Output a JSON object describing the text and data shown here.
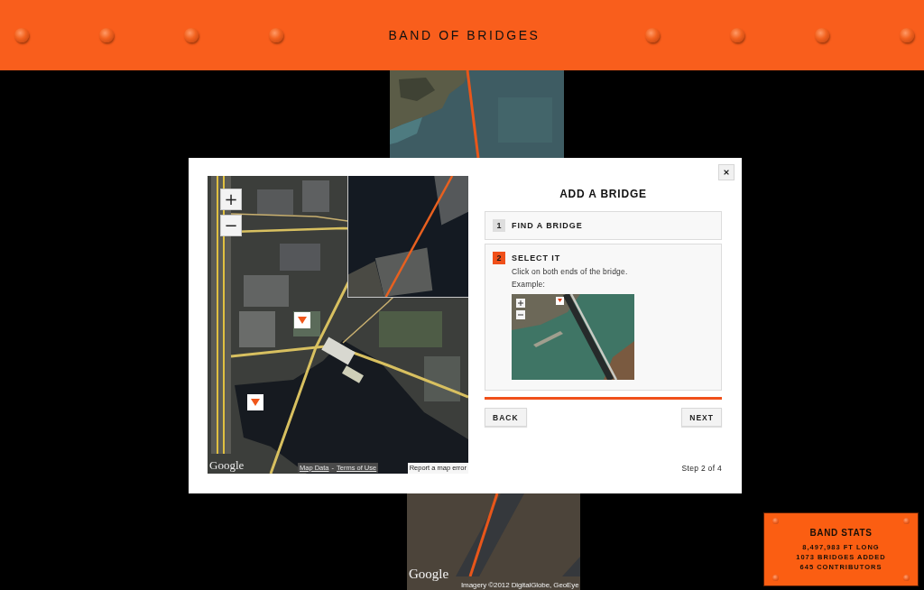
{
  "header": {
    "title": "BAND OF BRIDGES"
  },
  "background_map": {
    "logo": "Google",
    "attribution": "Imagery ©2012 DigitalGlobe, GeoEye"
  },
  "dialog": {
    "title": "ADD A BRIDGE",
    "map": {
      "zoom_in": "+",
      "zoom_out": "−",
      "logo": "Google",
      "links": [
        "Map Data",
        "Terms of Use"
      ],
      "link_separator": "-",
      "report": "Report a map error"
    },
    "steps": [
      {
        "number": "1",
        "title": "FIND A BRIDGE",
        "selected": false
      },
      {
        "number": "2",
        "title": "SELECT IT",
        "selected": true,
        "description": "Click on both ends of the bridge.",
        "example_label": "Example:"
      }
    ],
    "buttons": [
      {
        "kind": "back",
        "label": "BACK"
      },
      {
        "kind": "next",
        "label": "NEXT"
      }
    ],
    "step_count": "Step 2 of 4"
  },
  "band_stats": {
    "title": "BAND STATS",
    "lines": [
      "8,497,983 FT LONG",
      "1073 BRIDGES ADDED",
      "645 CONTRIBUTORS"
    ]
  }
}
